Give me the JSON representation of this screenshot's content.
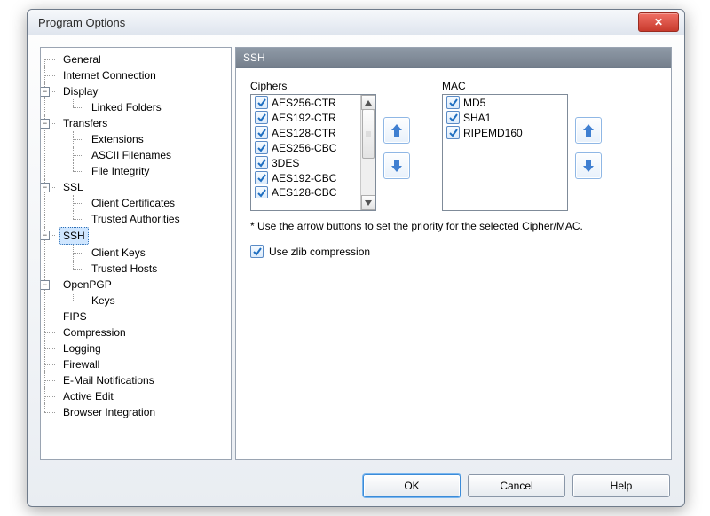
{
  "window": {
    "title": "Program Options"
  },
  "tree": {
    "general": "General",
    "internet": "Internet Connection",
    "display": {
      "label": "Display",
      "children": [
        "Linked Folders"
      ]
    },
    "transfers": {
      "label": "Transfers",
      "children": [
        "Extensions",
        "ASCII Filenames",
        "File Integrity"
      ]
    },
    "ssl": {
      "label": "SSL",
      "children": [
        "Client Certificates",
        "Trusted Authorities"
      ]
    },
    "ssh": {
      "label": "SSH",
      "children": [
        "Client Keys",
        "Trusted Hosts"
      ],
      "selected": true
    },
    "openpgp": {
      "label": "OpenPGP",
      "children": [
        "Keys"
      ]
    },
    "fips": "FIPS",
    "compression": "Compression",
    "logging": "Logging",
    "firewall": "Firewall",
    "email": "E-Mail Notifications",
    "activeedit": "Active Edit",
    "browser": "Browser Integration"
  },
  "panel": {
    "title": "SSH",
    "ciphers": {
      "label": "Ciphers",
      "items": [
        {
          "name": "AES256-CTR",
          "checked": true
        },
        {
          "name": "AES192-CTR",
          "checked": true
        },
        {
          "name": "AES128-CTR",
          "checked": true
        },
        {
          "name": "AES256-CBC",
          "checked": true
        },
        {
          "name": "3DES",
          "checked": true
        },
        {
          "name": "AES192-CBC",
          "checked": true
        },
        {
          "name": "AES128-CBC",
          "checked": true
        }
      ],
      "last_cut": true
    },
    "mac": {
      "label": "MAC",
      "items": [
        {
          "name": "MD5",
          "checked": true
        },
        {
          "name": "SHA1",
          "checked": true
        },
        {
          "name": "RIPEMD160",
          "checked": true
        }
      ]
    },
    "hint": "* Use the arrow buttons to set the priority for the selected Cipher/MAC.",
    "zlib_label": "Use zlib compression",
    "zlib_checked": true
  },
  "buttons": {
    "ok": "OK",
    "cancel": "Cancel",
    "help": "Help"
  },
  "colors": {
    "accent": "#3f7fd1",
    "selection": "#cfe6ff"
  }
}
